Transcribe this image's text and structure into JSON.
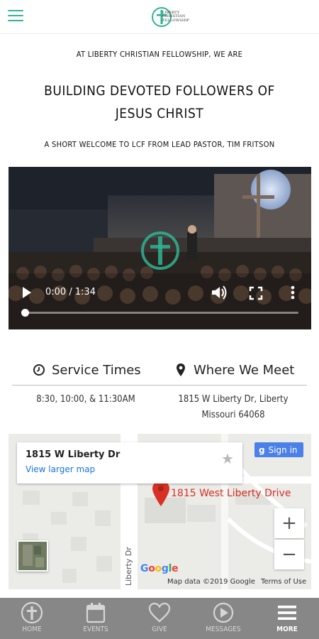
{
  "header": {
    "logo_text": [
      "LIBERTY",
      "CHRISTIAN",
      "FELLOWSHIP"
    ],
    "accent_color": "#2fb393"
  },
  "intro": {
    "kicker": "AT LIBERTY CHRISTIAN FELLOWSHIP, WE ARE",
    "headline_line1": "BUILDING DEVOTED FOLLOWERS OF",
    "headline_line2": "JESUS CHRIST",
    "subtitle": "A SHORT WELCOME TO LCF FROM LEAD PASTOR, TIM FRITSON"
  },
  "video": {
    "time": "0:00 / 1:34",
    "progress_fraction": 0,
    "controls": [
      "play-icon",
      "volume-icon",
      "fullscreen-icon",
      "more-vert-icon"
    ]
  },
  "info": {
    "service_times": {
      "title": "Service Times",
      "icon": "clock-icon",
      "text": "8:30, 10:00, & 11:30AM"
    },
    "where_we_meet": {
      "title": "Where We Meet",
      "icon": "location-pin-icon",
      "line1": "1815 W Liberty Dr, Liberty",
      "line2": "Missouri 64068"
    }
  },
  "map": {
    "card_title": "1815 W Liberty Dr",
    "card_link": "View larger map",
    "signin_label": "Sign in",
    "signin_g": "g",
    "pin_label": "1815 West Liberty Drive",
    "road_label": "Liberty Dr",
    "zoom_in": "+",
    "zoom_out": "−",
    "google": "Google",
    "credit_data": "Map data ©2019 Google",
    "credit_terms": "Terms of Use"
  },
  "nav": {
    "background": "#878787",
    "items": [
      {
        "label": "HOME",
        "icon": "cross-circle-icon"
      },
      {
        "label": "EVENTS",
        "icon": "calendar-icon"
      },
      {
        "label": "GIVE",
        "icon": "heart-icon"
      },
      {
        "label": "MESSAGES",
        "icon": "play-circle-icon"
      },
      {
        "label": "MORE",
        "icon": "menu-icon",
        "active": true
      }
    ]
  }
}
